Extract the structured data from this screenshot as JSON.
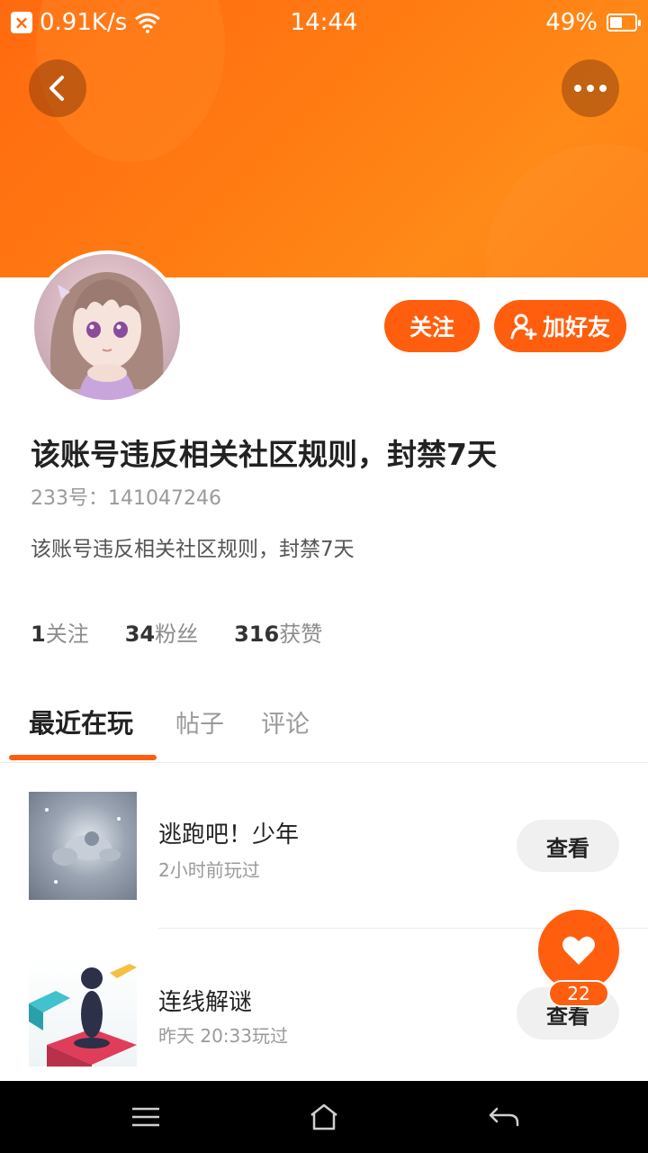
{
  "status_bar": {
    "speed": "0.91K/s",
    "time": "14:44",
    "battery": "49%",
    "battery_level": 0.49
  },
  "header": {
    "back_icon": "chevron-left-icon",
    "more_icon": "more-dots-icon"
  },
  "profile": {
    "follow_label": "关注",
    "add_friend_label": "加好友",
    "name": "该账号违反相关社区规则，封禁7天",
    "uid": "233号：141047246",
    "bio": "该账号违反相关社区规则，封禁7天",
    "stats": [
      {
        "num": "1",
        "label": "关注"
      },
      {
        "num": "34",
        "label": "粉丝"
      },
      {
        "num": "316",
        "label": "获赞"
      }
    ]
  },
  "tabs": [
    {
      "label": "最近在玩",
      "active": true
    },
    {
      "label": "帖子",
      "active": false
    },
    {
      "label": "评论",
      "active": false
    }
  ],
  "games": [
    {
      "title": "逃跑吧！少年",
      "subtitle": "2小时前玩过",
      "button": "查看"
    },
    {
      "title": "连线解谜",
      "subtitle": "昨天 20:33玩过",
      "button": "查看"
    }
  ],
  "like": {
    "count": "22"
  },
  "colors": {
    "accent": "#ff5e0e",
    "banner": "#ff7b12"
  }
}
